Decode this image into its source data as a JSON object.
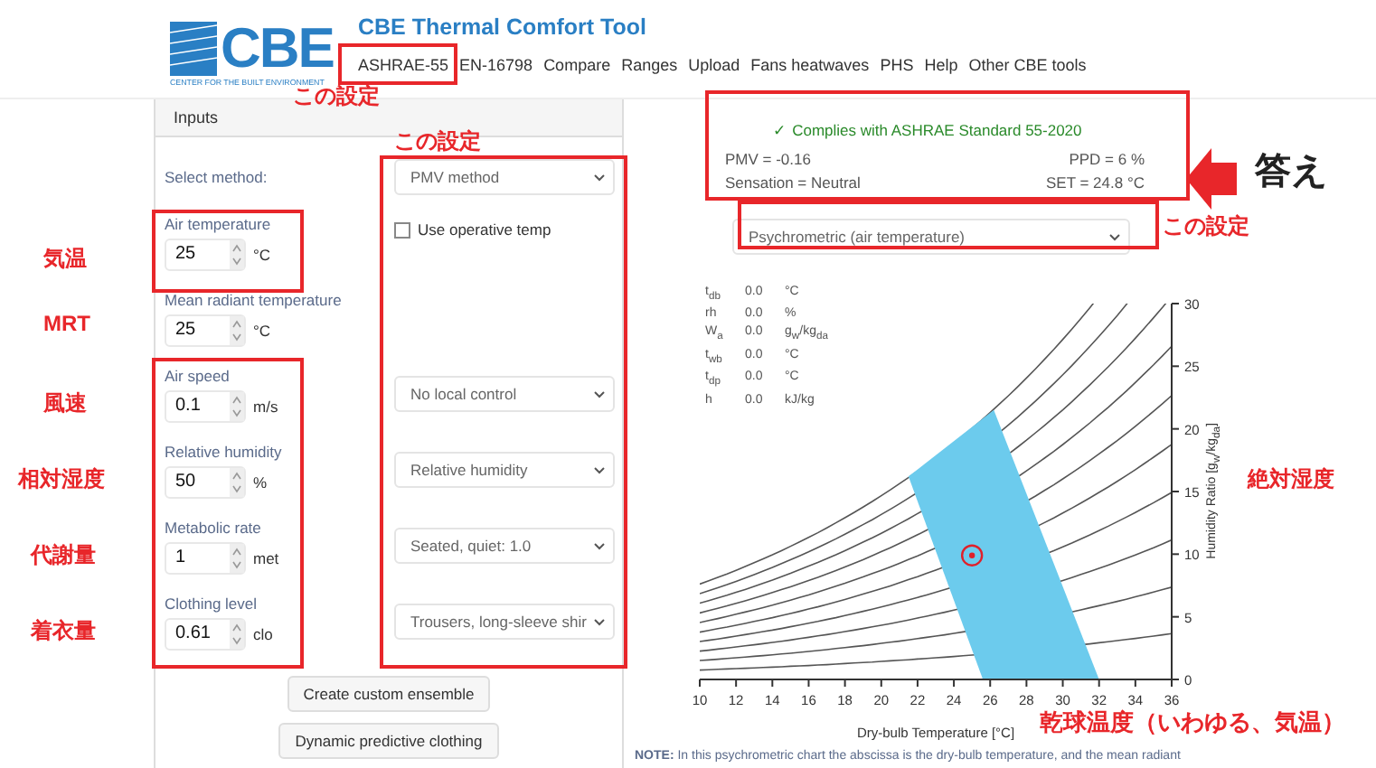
{
  "header": {
    "logo": "CBE",
    "logo_tagline": "CENTER FOR THE BUILT ENVIRONMENT",
    "title": "CBE Thermal Comfort Tool",
    "nav": [
      "ASHRAE-55",
      "EN-16798",
      "Compare",
      "Ranges",
      "Upload",
      "Fans heatwaves",
      "PHS",
      "Help",
      "Other CBE tools"
    ]
  },
  "inputs": {
    "title": "Inputs",
    "method_label": "Select method:",
    "method": "PMV method",
    "fields": [
      {
        "label": "Air temperature",
        "value": "25",
        "unit": "°C",
        "option": {
          "kind": "checkbox",
          "label": "Use operative temp",
          "checked": false
        }
      },
      {
        "label": "Mean radiant temperature",
        "value": "25",
        "unit": "°C"
      },
      {
        "label": "Air speed",
        "value": "0.1",
        "unit": "m/s",
        "option": {
          "kind": "select",
          "value": "No local control"
        }
      },
      {
        "label": "Relative humidity",
        "value": "50",
        "unit": "%",
        "option": {
          "kind": "select",
          "value": "Relative humidity"
        }
      },
      {
        "label": "Metabolic rate",
        "value": "1",
        "unit": "met",
        "option": {
          "kind": "select",
          "value": "Seated, quiet: 1.0"
        }
      },
      {
        "label": "Clothing level",
        "value": "0.61",
        "unit": "clo",
        "option": {
          "kind": "select",
          "value": "Trousers, long-sleeve shir"
        }
      }
    ],
    "buttons": [
      "Create custom ensemble",
      "Dynamic predictive clothing"
    ]
  },
  "results": {
    "compliance": "Complies with ASHRAE Standard 55-2020",
    "complies": true,
    "check": "✓",
    "pmv": "PMV = -0.16",
    "ppd": "PPD = 6 %",
    "sensation": "Sensation = Neutral",
    "set": "SET = 24.8 °C"
  },
  "chart_select": "Psychrometric (air temperature)",
  "readout": [
    {
      "label": "t$_{db}$",
      "value": "0.0",
      "unit": "°C"
    },
    {
      "label": "rh",
      "value": "0.0",
      "unit": "%"
    },
    {
      "label": "W$_{a}$",
      "value": "0.0",
      "unit": "g$_{w}$/kg$_{da}$"
    },
    {
      "label": "t$_{wb}$",
      "value": "0.0",
      "unit": "°C"
    },
    {
      "label": "t$_{dp}$",
      "value": "0.0",
      "unit": "°C"
    },
    {
      "label": "h",
      "value": "0.0",
      "unit": "kJ/kg"
    }
  ],
  "chart_data": {
    "type": "scatter",
    "xlabel": "Dry-bulb Temperature [°C]",
    "ylabel": "Humidity Ratio [g$_{w}$/kg$_{da}$]",
    "xlim": [
      10,
      36
    ],
    "ylim": [
      0,
      30
    ],
    "xticks": [
      10,
      12,
      14,
      16,
      18,
      20,
      22,
      24,
      26,
      28,
      30,
      32,
      34,
      36
    ],
    "yticks": [
      0,
      5,
      10,
      15,
      20,
      25,
      30
    ],
    "x": [
      25
    ],
    "series": [
      {
        "color": "#e0202a",
        "values": [
          9.9
        ]
      }
    ]
  },
  "note": "**NOTE:** In this psychrometric chart the abscissa is the dry-bulb temperature, and the mean radiant",
  "callouts": [
    {
      "text": "この設定"
    },
    {
      "text": "この設定"
    },
    {
      "text": "気温"
    },
    {
      "text": "MRT"
    },
    {
      "text": "風速"
    },
    {
      "text": "相対湿度"
    },
    {
      "text": "代謝量"
    },
    {
      "text": "着衣量"
    },
    {
      "text": "答え"
    },
    {
      "text": "この設定"
    },
    {
      "text": "絶対湿度"
    },
    {
      "text": "乾球温度（いわゆる、気温）"
    }
  ]
}
